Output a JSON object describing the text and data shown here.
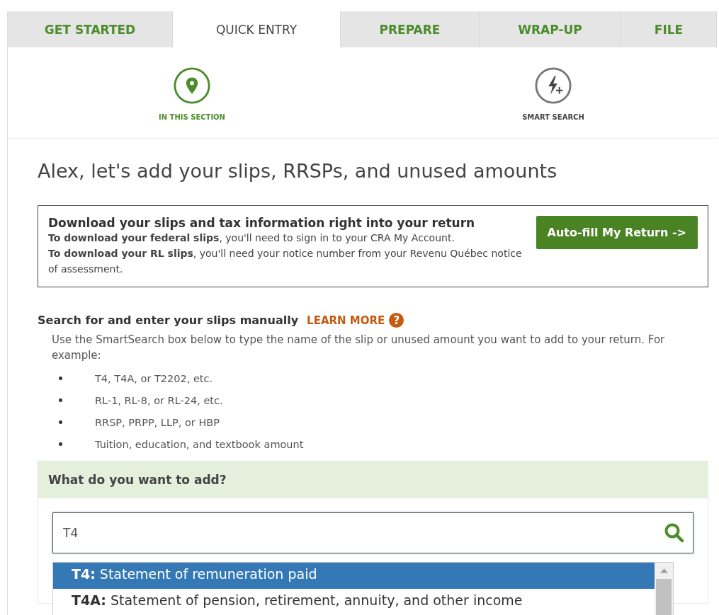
{
  "tabs": [
    {
      "label": "GET STARTED",
      "selected": false
    },
    {
      "label": "QUICK ENTRY",
      "selected": true
    },
    {
      "label": "PREPARE",
      "selected": false
    },
    {
      "label": "WRAP-UP",
      "selected": false
    },
    {
      "label": "FILE",
      "selected": false
    }
  ],
  "section_nav": [
    {
      "label": "IN THIS SECTION",
      "kind": "pin",
      "selected": true
    },
    {
      "label": "SMART SEARCH",
      "kind": "bolt",
      "selected": false
    }
  ],
  "heading": "Alex, let's add your slips, RRSPs, and unused amounts",
  "download_box": {
    "title": "Download your slips and tax information right into your return",
    "lines": [
      "**To download your federal slips**, you'll need to sign in to your CRA My Account.",
      "**To download your RL slips**, you'll need your notice number from your Revenu Québec notice of assessment."
    ],
    "button": "Auto-fill My Return ->"
  },
  "manual": {
    "title": "Search for and enter your slips manually",
    "learn_more": "LEARN MORE",
    "help_icon": "?",
    "intro": "Use the SmartSearch box below to type the name of the slip or unused amount you want to add to your return. For example:",
    "examples": [
      "T4, T4A, or T2202, etc.",
      "RL-1, RL-8, or RL-24, etc.",
      "RRSP, PRPP, LLP, or HBP",
      "Tuition, education, and textbook amount"
    ]
  },
  "search_panel": {
    "title": "What do you want to add?",
    "value": "T4"
  },
  "suggestions": [
    {
      "text": "**T4:** Statement of remuneration paid",
      "selected": true
    },
    {
      "text": "**T4A:** Statement of pension, retirement, annuity, and other income",
      "selected": false
    }
  ]
}
